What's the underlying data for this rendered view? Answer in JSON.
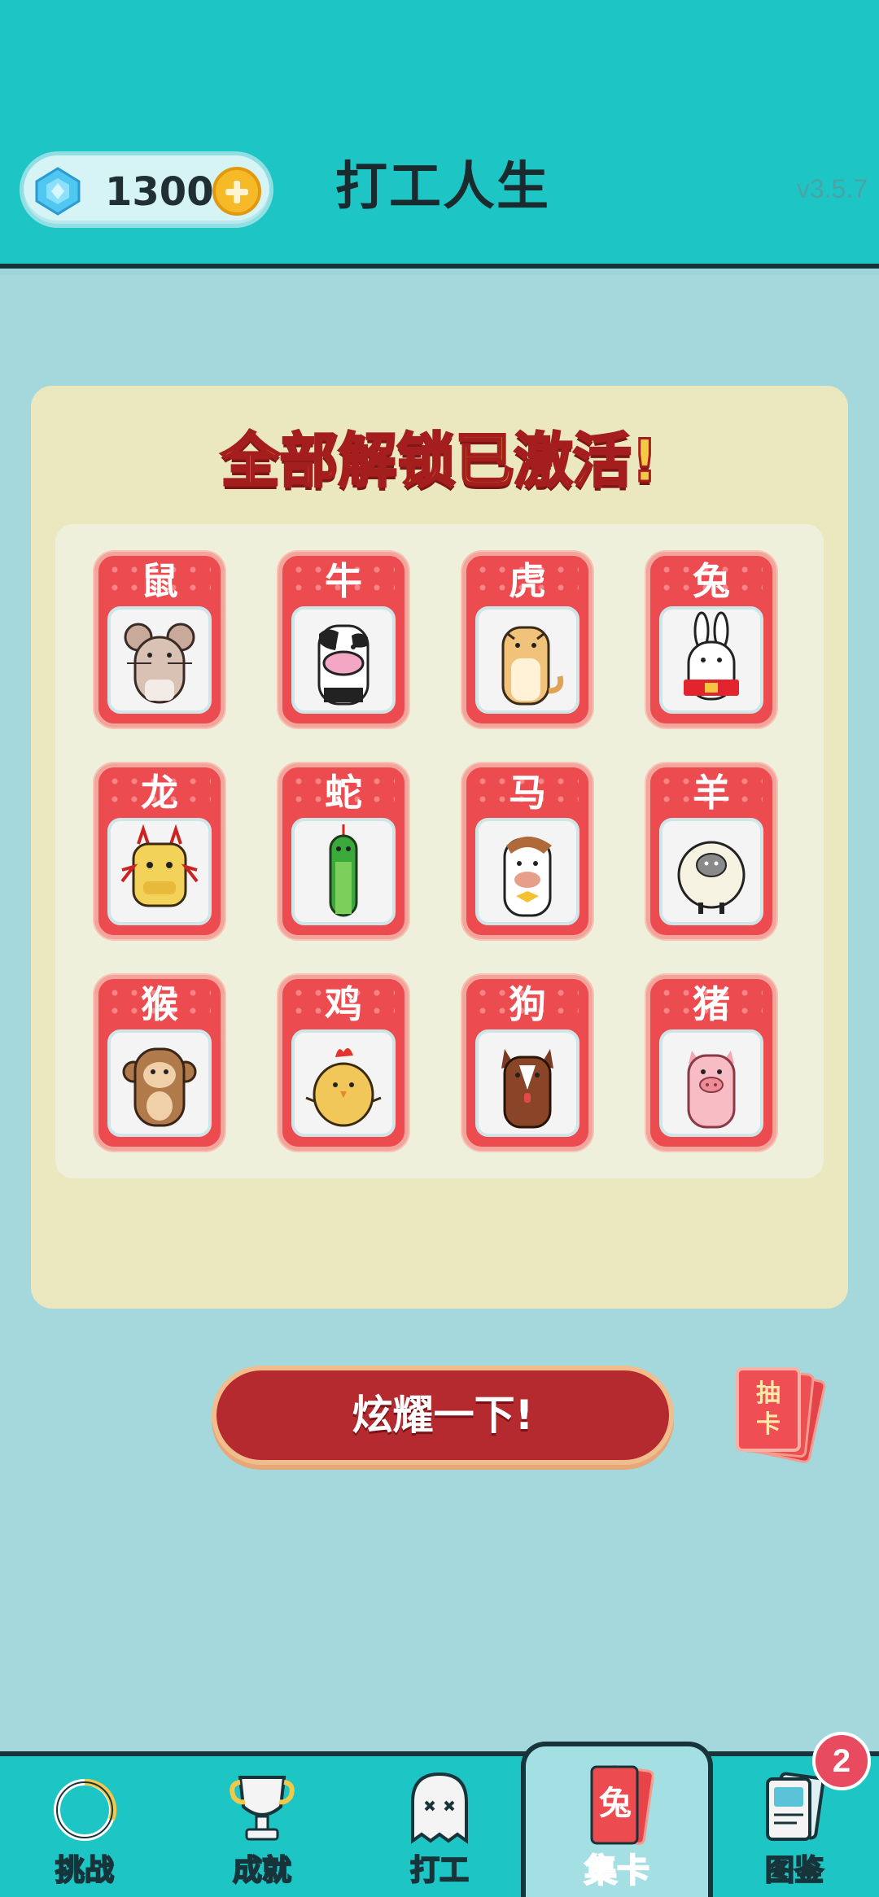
{
  "header": {
    "gem_count": "1300",
    "title": "打工人生",
    "version": "v3.5.7"
  },
  "panel": {
    "title": "全部解锁已激活!",
    "cards": [
      {
        "name": "鼠",
        "icon": "rat-icon"
      },
      {
        "name": "牛",
        "icon": "ox-icon"
      },
      {
        "name": "虎",
        "icon": "tiger-icon"
      },
      {
        "name": "兔",
        "icon": "rabbit-icon"
      },
      {
        "name": "龙",
        "icon": "dragon-icon"
      },
      {
        "name": "蛇",
        "icon": "snake-icon"
      },
      {
        "name": "马",
        "icon": "horse-icon"
      },
      {
        "name": "羊",
        "icon": "sheep-icon"
      },
      {
        "name": "猴",
        "icon": "monkey-icon"
      },
      {
        "name": "鸡",
        "icon": "rooster-icon"
      },
      {
        "name": "狗",
        "icon": "dog-icon"
      },
      {
        "name": "猪",
        "icon": "pig-icon"
      }
    ]
  },
  "actions": {
    "show_off_label": "炫耀一下!",
    "draw_card_line1": "抽",
    "draw_card_line2": "卡"
  },
  "nav": {
    "items": [
      {
        "label": "挑战",
        "icon": "challenge-ring-icon"
      },
      {
        "label": "成就",
        "icon": "trophy-icon"
      },
      {
        "label": "打工",
        "icon": "ghost-icon"
      },
      {
        "label": "集卡",
        "icon": "card-collection-icon",
        "card_char": "兔"
      },
      {
        "label": "图鉴",
        "icon": "handbook-icon"
      }
    ],
    "active_index": 3,
    "badge_count": "2"
  },
  "colors": {
    "header_bg": "#1ec5c5",
    "page_bg": "#a4d8dd",
    "card_red": "#ec4b4f",
    "panel_bg": "#ebe7bf",
    "button_red": "#b52a2f"
  }
}
